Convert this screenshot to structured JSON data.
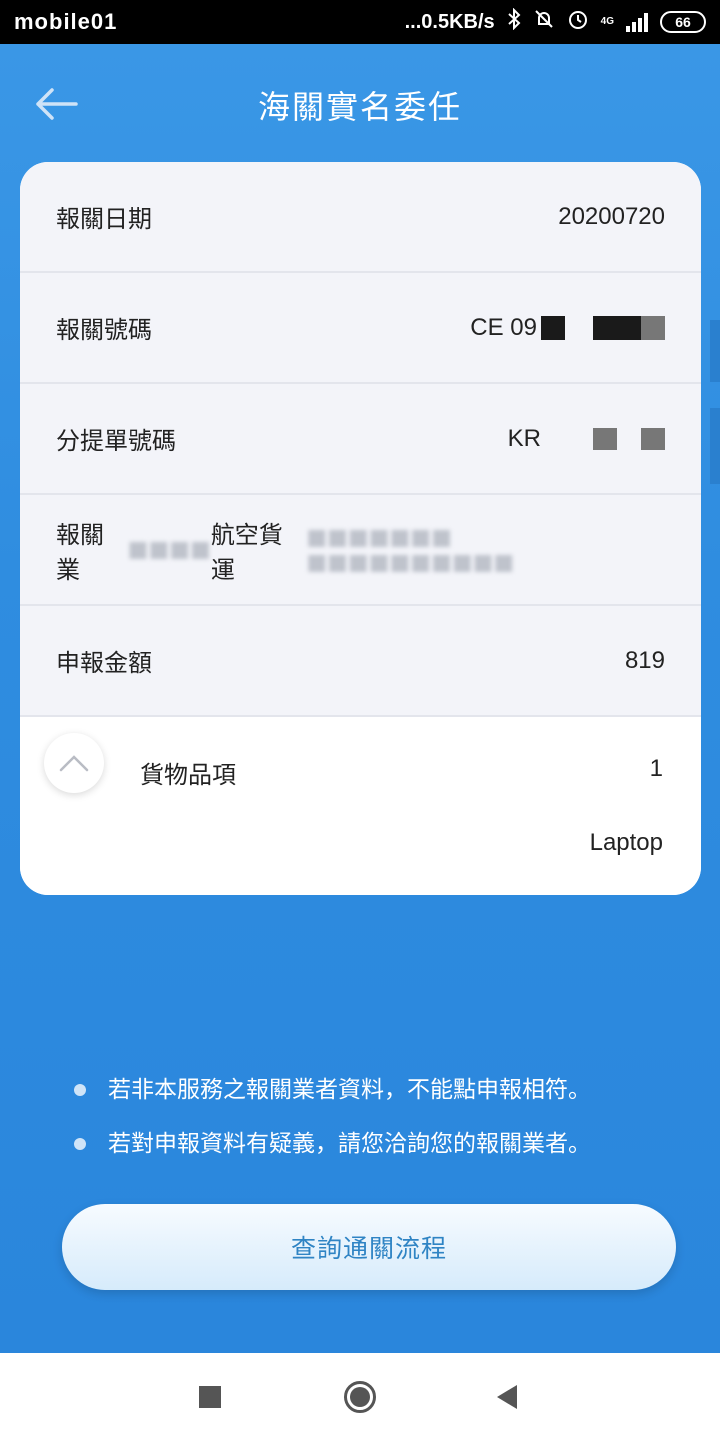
{
  "status_bar": {
    "left_text": "mobile01",
    "net_speed": "...0.5KB/s",
    "network": "4G",
    "battery": "66"
  },
  "header": {
    "title": "海關實名委任"
  },
  "card": {
    "rows": [
      {
        "label": "報關日期",
        "value": "20200720"
      },
      {
        "label": "報關號碼",
        "value": "CE  09"
      },
      {
        "label": "分提單號碼",
        "value": "KR"
      },
      {
        "label": "報關業",
        "value": "航空貨運"
      },
      {
        "label": "申報金額",
        "value": "819"
      }
    ],
    "goods": {
      "label": "貨物品項",
      "count": "1",
      "item": "Laptop"
    }
  },
  "notes": [
    "若非本服務之報關業者資料，不能點申報相符。",
    "若對申報資料有疑義，請您洽詢您的報關業者。"
  ],
  "query_button": "查詢通關流程",
  "icons": {
    "back": "arrow-left-icon",
    "collapse": "chevron-up-icon",
    "nav_recent": "square-icon",
    "nav_home": "circle-icon",
    "nav_back": "triangle-left-icon"
  },
  "colors": {
    "primary_blue": "#2f8de0",
    "button_text": "#2f84c4"
  }
}
